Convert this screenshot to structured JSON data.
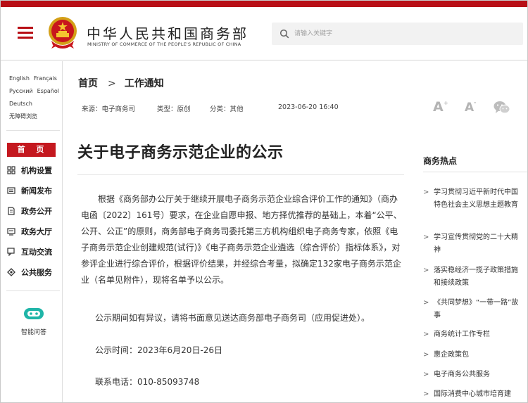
{
  "header": {
    "site_name_cn": "中华人民共和国商务部",
    "site_name_en": "MINISTRY OF COMMERCE OF THE PEOPLE'S REPUBLIC OF CHINA",
    "search_placeholder": "请输入关键字"
  },
  "sidebar": {
    "languages": [
      [
        "English",
        "Français"
      ],
      [
        "Русский",
        "Español"
      ],
      [
        "Deutsch"
      ],
      [
        "无障碍浏览"
      ]
    ],
    "home": "首 页",
    "items": [
      {
        "label": "机构设置",
        "icon": "org-icon"
      },
      {
        "label": "新闻发布",
        "icon": "news-icon"
      },
      {
        "label": "政务公开",
        "icon": "document-icon"
      },
      {
        "label": "政务大厅",
        "icon": "hall-icon"
      },
      {
        "label": "互动交流",
        "icon": "chat-icon"
      },
      {
        "label": "公共服务",
        "icon": "service-icon"
      }
    ],
    "assistant": {
      "label": "智能问答",
      "icon": "robot-icon"
    }
  },
  "breadcrumb": {
    "home": "首页",
    "separator": ">",
    "current": "工作通知"
  },
  "meta": {
    "source": "来源：电子商务司",
    "type": "类型：原创",
    "category": "分类：其他",
    "datetime": "2023-06-20 16:40"
  },
  "tools": {
    "font_large": "A",
    "font_small": "A",
    "wechat_icon": "wechat-icon"
  },
  "article": {
    "title": "关于电子商务示范企业的公示",
    "paragraph1": "根据《商务部办公厅关于继续开展电子商务示范企业综合评价工作的通知》（商办电函〔2022〕161号）要求，在企业自愿申报、地方择优推荐的基础上，本着“公平、公开、公正”的原则，商务部电子商务司委托第三方机构组织电子商务专家，依照《电子商务示范企业创建规范(试行)》《电子商务示范企业遴选（综合评价）指标体系》，对参评企业进行综合评价，根据评价结果，并经综合考量，拟确定132家电子商务示范企业（名单见附件），现将名单予以公示。",
    "paragraph2": "公示期间如有异议，请将书面意见送达商务部电子商务司（应用促进处）。",
    "paragraph3": "公示时间：2023年6月20日-26日",
    "paragraph4": "联系电话：010-85093748"
  },
  "hot": {
    "heading": "商务热点",
    "items": [
      "学习贯彻习近平新时代中国特色社会主义思想主题教育",
      "学习宣传贯彻党的二十大精神",
      "落实稳经济一揽子政策措施和接续政策",
      "《共同梦想》“一带一路”故事",
      "商务统计工作专栏",
      "惠企政策包",
      "电子商务公共服务",
      "国际消费中心城市培育建"
    ]
  },
  "colors": {
    "brand_red": "#b80f16",
    "home_red": "#c4181f",
    "assistant_teal": "#1fb5a8"
  }
}
